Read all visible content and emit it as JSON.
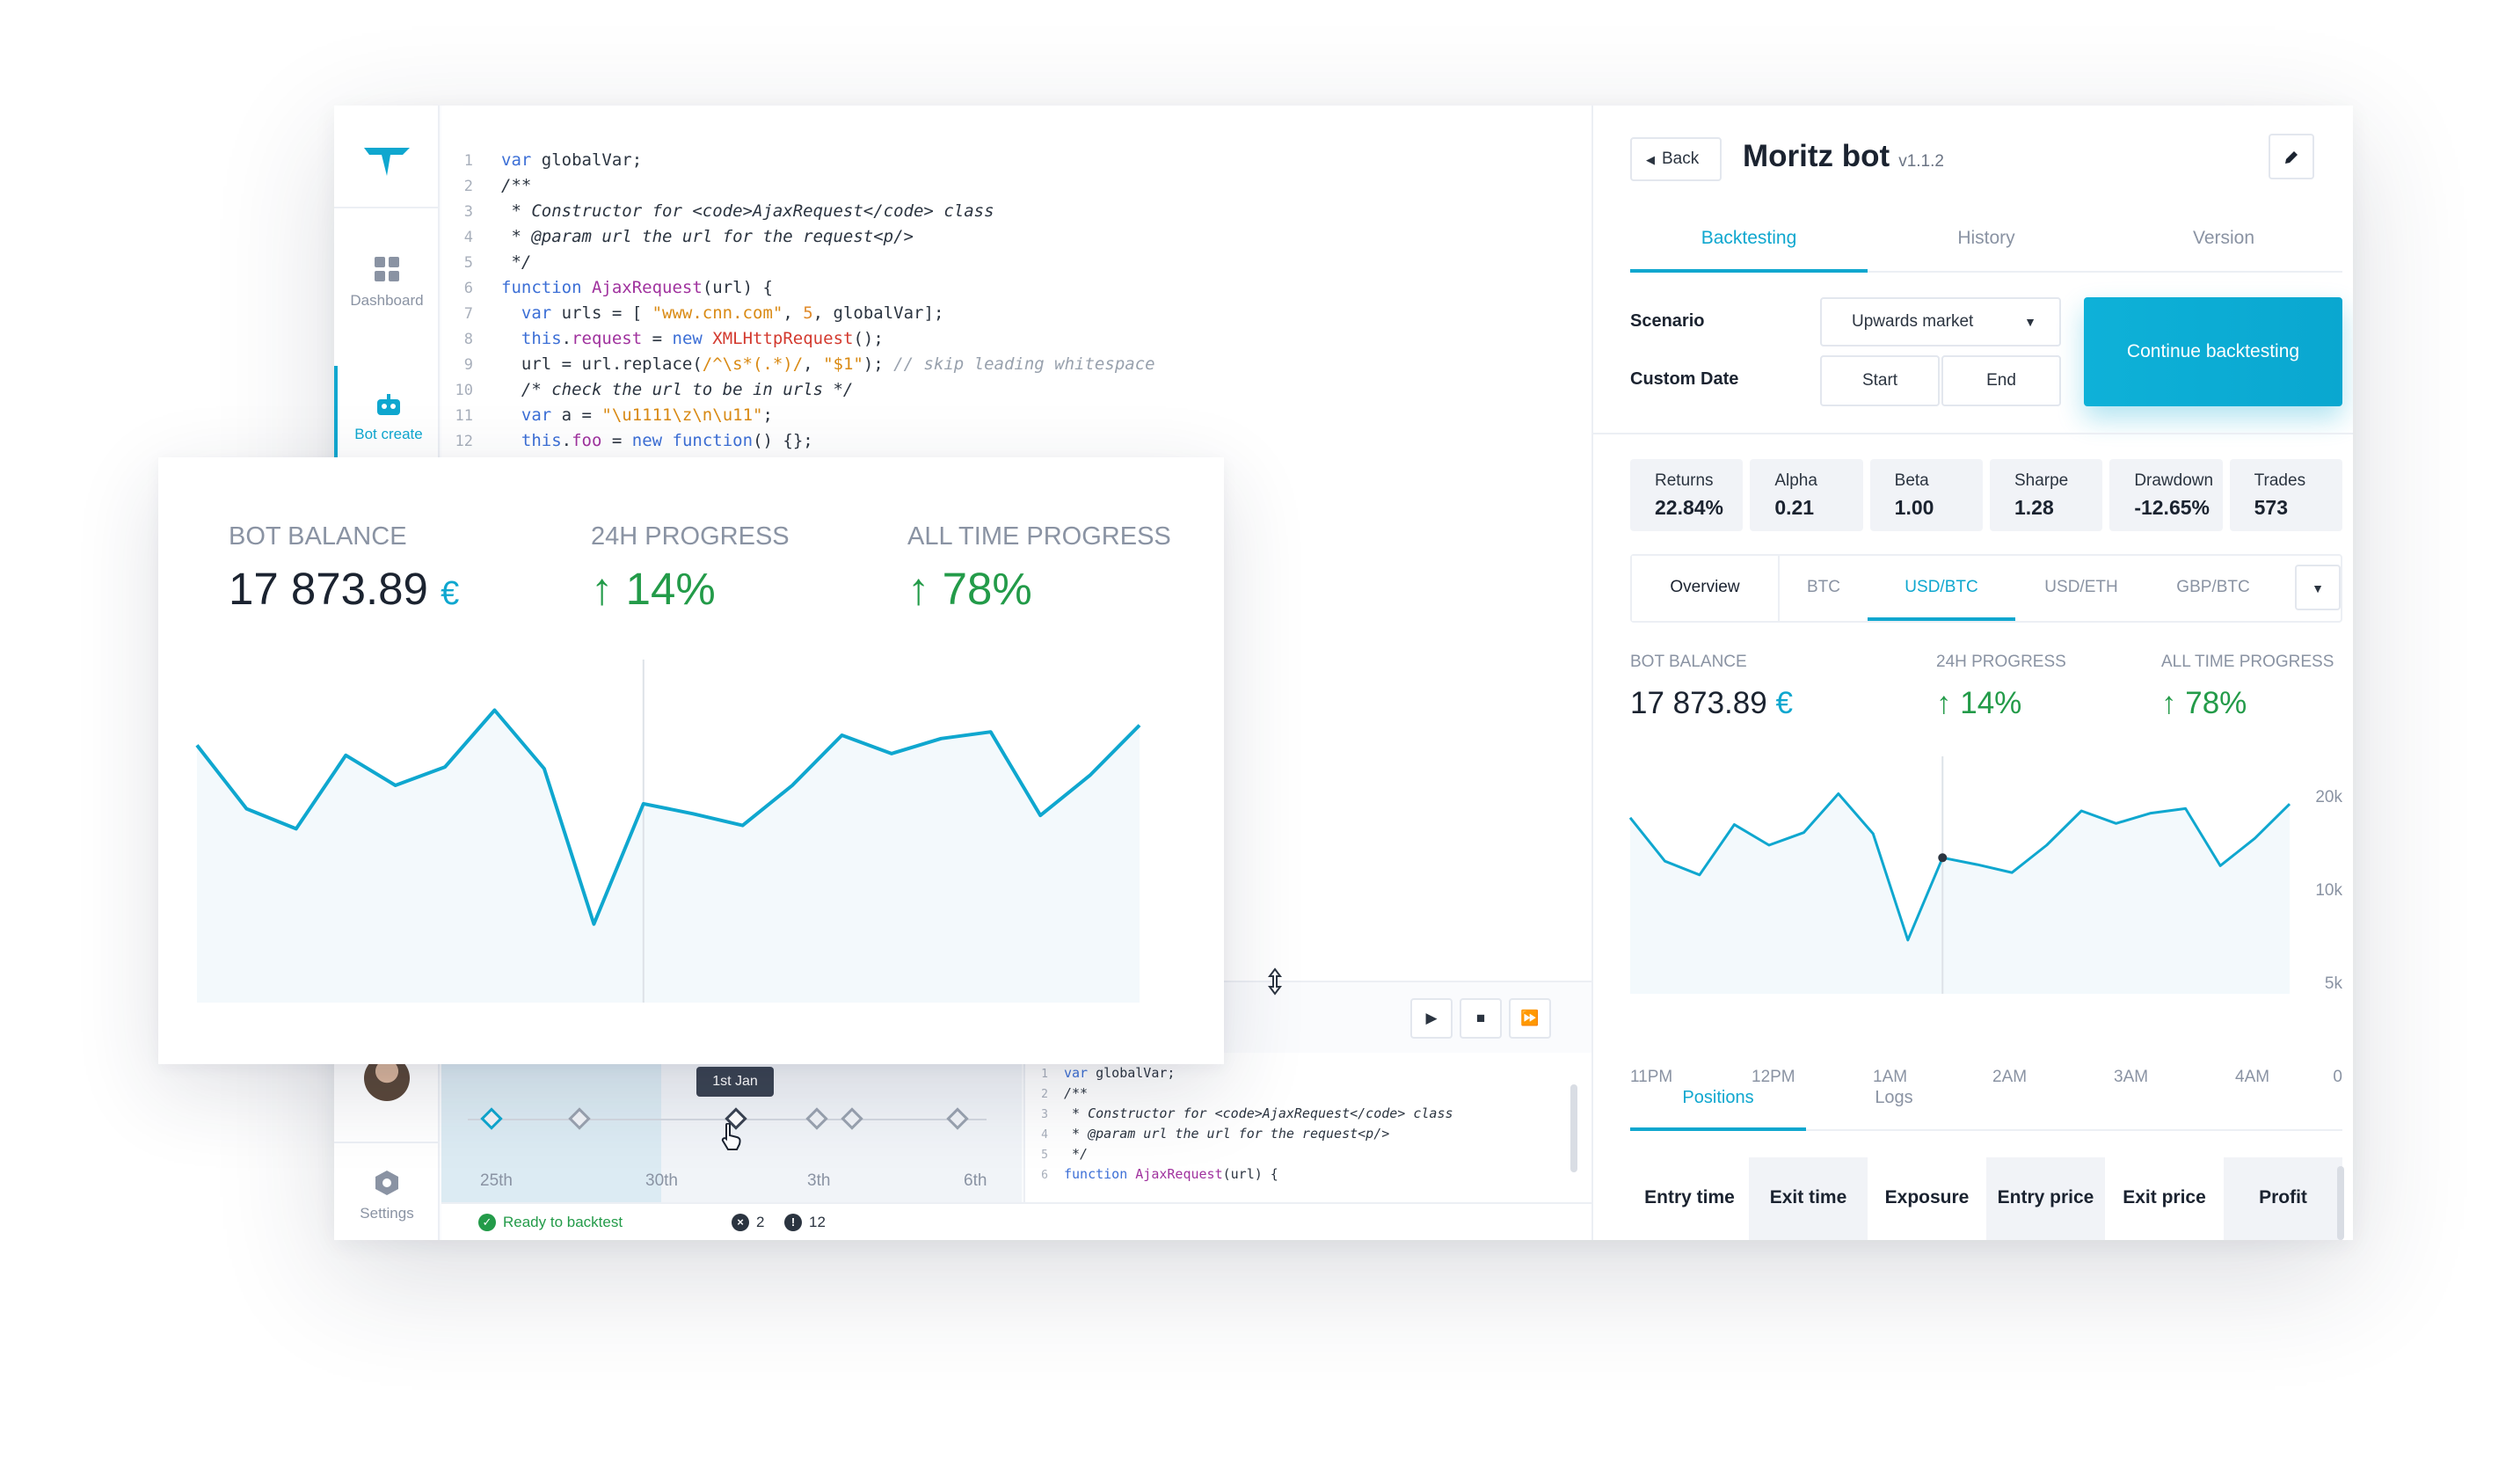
{
  "sidebar": {
    "items": [
      {
        "label": "Dashboard",
        "icon": "grid-icon"
      },
      {
        "label": "Bot create",
        "icon": "bot-icon"
      },
      {
        "label": "Settings",
        "icon": "hexagon-icon"
      }
    ]
  },
  "editor": {
    "lines": [
      {
        "n": "1",
        "text": "var globalVar;"
      },
      {
        "n": "2",
        "text": "/**"
      },
      {
        "n": "3",
        "text": " * Constructor for <code>AjaxRequest</code> class"
      },
      {
        "n": "4",
        "text": " * @param url the url for the request<p/>"
      },
      {
        "n": "5",
        "text": " */"
      },
      {
        "n": "6",
        "text": "function AjaxRequest(url) {"
      },
      {
        "n": "7",
        "text": "  var urls = [ \"www.cnn.com\", 5, globalVar];"
      },
      {
        "n": "8",
        "text": "  this.request = new XMLHttpRequest();"
      },
      {
        "n": "9",
        "text": "  url = url.replace(/^\\s*(.*)/, \"$1\"); // skip leading whitespace"
      },
      {
        "n": "10",
        "text": "  /* check the url to be in urls */"
      },
      {
        "n": "11",
        "text": "  var a = \"\\u1111\\z\\n\\u11\";"
      },
      {
        "n": "12",
        "text": "  this.foo = new function() {};"
      }
    ]
  },
  "mini_editor": {
    "lines": [
      {
        "n": "1",
        "text": "var globalVar;"
      },
      {
        "n": "2",
        "text": "/**"
      },
      {
        "n": "3",
        "text": " * Constructor for <code>AjaxRequest</code> class"
      },
      {
        "n": "4",
        "text": " * @param url the url for the request<p/>"
      },
      {
        "n": "5",
        "text": " */"
      },
      {
        "n": "6",
        "text": "function AjaxRequest(url) {"
      }
    ]
  },
  "playback": {
    "play_icon": "▶",
    "stop_icon": "■",
    "forward_icon": "⏩"
  },
  "timeline": {
    "tooltip": "1st Jan",
    "labels": [
      "25th",
      "30th",
      "3th",
      "6th"
    ]
  },
  "status": {
    "ready": "Ready to backtest",
    "errors": "2",
    "warnings": "12"
  },
  "panel": {
    "back_label": "Back",
    "title": "Moritz bot",
    "version": "v1.1.2",
    "tabs": [
      "Backtesting",
      "History",
      "Version"
    ],
    "scenario_label": "Scenario",
    "scenario_value": "Upwards market",
    "custom_date_label": "Custom Date",
    "start_label": "Start",
    "end_label": "End",
    "continue_label": "Continue backtesting",
    "stats": [
      {
        "label": "Returns",
        "value": "22.84%"
      },
      {
        "label": "Alpha",
        "value": "0.21"
      },
      {
        "label": "Beta",
        "value": "1.00"
      },
      {
        "label": "Sharpe",
        "value": "1.28"
      },
      {
        "label": "Drawdown",
        "value": "-12.65%"
      },
      {
        "label": "Trades",
        "value": "573"
      }
    ],
    "pair_tabs": [
      "Overview",
      "BTC",
      "USD/BTC",
      "USD/ETH",
      "GBP/BTC"
    ],
    "kpis": {
      "balance_label": "BOT BALANCE",
      "balance_value": "17 873.89",
      "currency": "€",
      "progress_24h_label": "24H PROGRESS",
      "progress_24h_value": "14%",
      "all_time_label": "ALL TIME PROGRESS",
      "all_time_value": "78%"
    },
    "bottom_tabs": [
      "Positions",
      "Logs"
    ],
    "table_headers": [
      "Entry time",
      "Exit time",
      "Exposure",
      "Entry price",
      "Exit price",
      "Profit"
    ]
  },
  "card": {
    "balance_label": "BOT BALANCE",
    "balance_value": "17 873.89",
    "currency": "€",
    "progress_24h_label": "24H PROGRESS",
    "progress_24h_value": "14%",
    "all_time_label": "ALL TIME PROGRESS",
    "all_time_value": "78%"
  },
  "chart_data": [
    {
      "type": "line",
      "values": [
        15.4,
        11.6,
        10.4,
        14.8,
        13.0,
        14.1,
        17.5,
        14.0,
        4.7,
        11.9,
        11.3,
        10.6,
        13.0,
        16.0,
        14.9,
        15.8,
        16.2,
        11.2,
        13.6,
        16.6
      ],
      "accent": "#0fa7cf"
    },
    {
      "type": "line",
      "x_ticks": [
        "11PM",
        "12PM",
        "1AM",
        "2AM",
        "3AM",
        "4AM"
      ],
      "y_ticks": [
        "20k",
        "10k",
        "5k",
        "0"
      ],
      "values": [
        15.4,
        11.6,
        10.4,
        14.8,
        13.0,
        14.1,
        17.5,
        14.0,
        4.7,
        11.9,
        11.3,
        10.6,
        13.0,
        16.0,
        14.9,
        15.8,
        16.2,
        11.2,
        13.6,
        16.6
      ],
      "accent": "#0fa7cf"
    }
  ]
}
